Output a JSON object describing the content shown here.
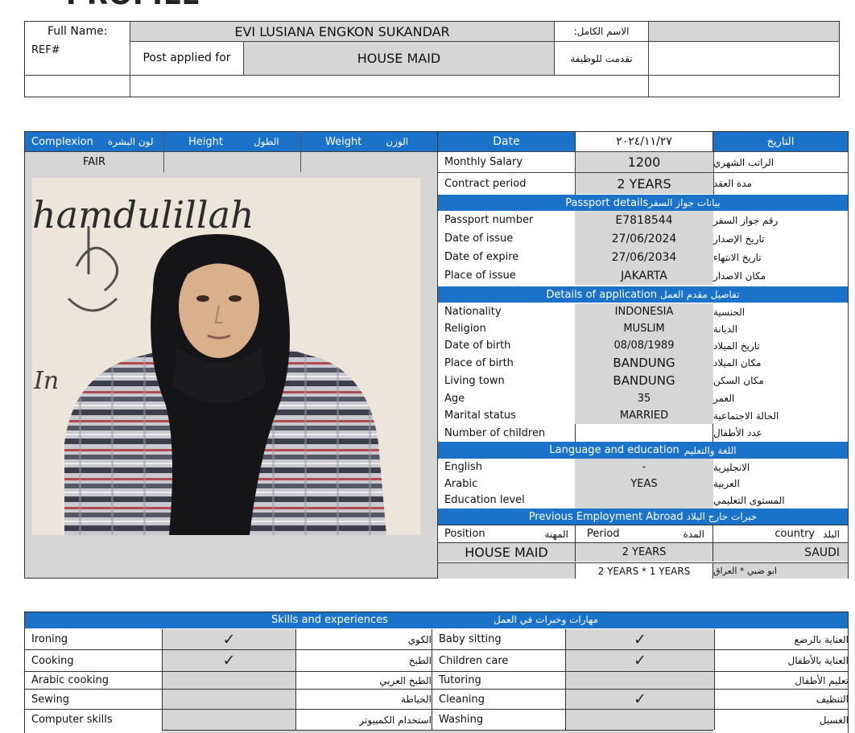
{
  "page_heading": "PROFILE",
  "top": {
    "full_name_label": "Full Name:",
    "full_name": "EVI LUSIANA ENGKON SUKANDAR",
    "full_name_ar": "الاسم الكامل:",
    "ref_label": "REF#",
    "post_label": "Post applied for",
    "post_value": "HOUSE  MAID",
    "post_ar": "تقدمت للوظيفة"
  },
  "phys": {
    "complexion": "Complexion",
    "complexion_ar": "لون البشرة",
    "height": "Height",
    "height_ar": "الطول",
    "weight": "Weight",
    "weight_ar": "الوزن",
    "complexion_value": "FAIR",
    "height_value": "",
    "weight_value": ""
  },
  "photo": {
    "wall_text": "hamdulillah",
    "wall_text2": "In"
  },
  "details": {
    "date_label": "Date",
    "date_value": "٢٠٢٤/١١/٢٧",
    "date_ar": "التاريخ",
    "salary_label": "Monthly Salary",
    "salary_value": "1200",
    "salary_ar": "الراتب الشهري",
    "contract_label": "Contract period",
    "contract_value": "2 YEARS",
    "contract_ar": "مدة العقد",
    "passport_header": "Passport details",
    "passport_header_ar": "بيانات جواز السفر",
    "passport_rows": [
      {
        "label": "Passport number",
        "value": "E7818544",
        "ar": "رقم جواز السفر"
      },
      {
        "label": "Date of issue",
        "value": "27/06/2024",
        "ar": "تاريخ الإصدار"
      },
      {
        "label": "Date of expire",
        "value": "27/06/2034",
        "ar": "تاريخ الانتهاء"
      },
      {
        "label": "Place of issue",
        "value": "JAKARTA",
        "ar": "مكان الاصدار"
      }
    ],
    "application_header": "Details of application",
    "application_header_ar": "تفاصيل مقدم العمل",
    "application_rows": [
      {
        "label": "Nationality",
        "value": "INDONESIA",
        "ar": "الجنسية"
      },
      {
        "label": "Religion",
        "value": "MUSLIM",
        "ar": "الديانة"
      },
      {
        "label": "Date of birth",
        "value": "08/08/1989",
        "ar": "تاريخ الميلاد"
      },
      {
        "label": "Place of birth",
        "value": "BANDUNG",
        "ar": "مكان الميلاد"
      },
      {
        "label": "Living town",
        "value": "BANDUNG",
        "ar": "مكان السكن"
      },
      {
        "label": "Age",
        "value": "35",
        "ar": "العمر"
      },
      {
        "label": "Marital status",
        "value": "MARRIED",
        "ar": "الحالة الاجتماعية"
      },
      {
        "label": "Number of children",
        "value": "",
        "ar": "عدد الأطفال"
      }
    ],
    "language_header": "Language and education",
    "language_header_ar": "اللغة والتعليم",
    "language_rows": [
      {
        "label": "English",
        "value": "-",
        "ar": "الانجليزية"
      },
      {
        "label": "Arabic",
        "value": "YEAS",
        "ar": "العربية"
      },
      {
        "label": "Education level",
        "value": "",
        "ar": "المستوى التعليمي"
      }
    ],
    "employment_header": "Previous Employment Abroad",
    "employment_header_ar": "خبرات خارج البلاد",
    "emp_position": "Position",
    "emp_position_ar": "المهنة",
    "emp_period": "Period",
    "emp_period_ar": "المدة",
    "emp_country": "country",
    "emp_country_ar": "البلد",
    "emp_rows": [
      {
        "position": "HOUSE  MAID",
        "period": "2 YEARS",
        "country": "SAUDI"
      },
      {
        "position": "",
        "period": "2 YEARS * 1 YEARS",
        "country": "ابو ضبي * العراق"
      }
    ]
  },
  "skills": {
    "header": "Skills and experiences",
    "header_ar": "مهارات وخبرات في العمل",
    "check_glyph": "✓",
    "left": [
      {
        "label": "Ironing",
        "ar": "الكوي",
        "checked": true
      },
      {
        "label": "Cooking",
        "ar": "الطبخ",
        "checked": true
      },
      {
        "label": "Arabic cooking",
        "ar": "الطبخ العربي",
        "checked": false
      },
      {
        "label": "Sewing",
        "ar": "الخياطة",
        "checked": false
      },
      {
        "label": "Computer skills",
        "ar": "استخدام الكمبيوتر",
        "checked": false
      }
    ],
    "right": [
      {
        "label": "Baby sitting",
        "ar": "العناية بالرضع",
        "checked": true
      },
      {
        "label": "Children care",
        "ar": "العناية بالأطفال",
        "checked": true
      },
      {
        "label": "Tutoring",
        "ar": "تعليم الأطفال",
        "checked": false
      },
      {
        "label": "Cleaning",
        "ar": "التنظيف",
        "checked": true
      },
      {
        "label": "Washing",
        "ar": "الغسيل",
        "checked": false
      }
    ]
  },
  "colors": {
    "header_blue": "#1a73c8",
    "cell_grey": "#d6d6d6"
  }
}
